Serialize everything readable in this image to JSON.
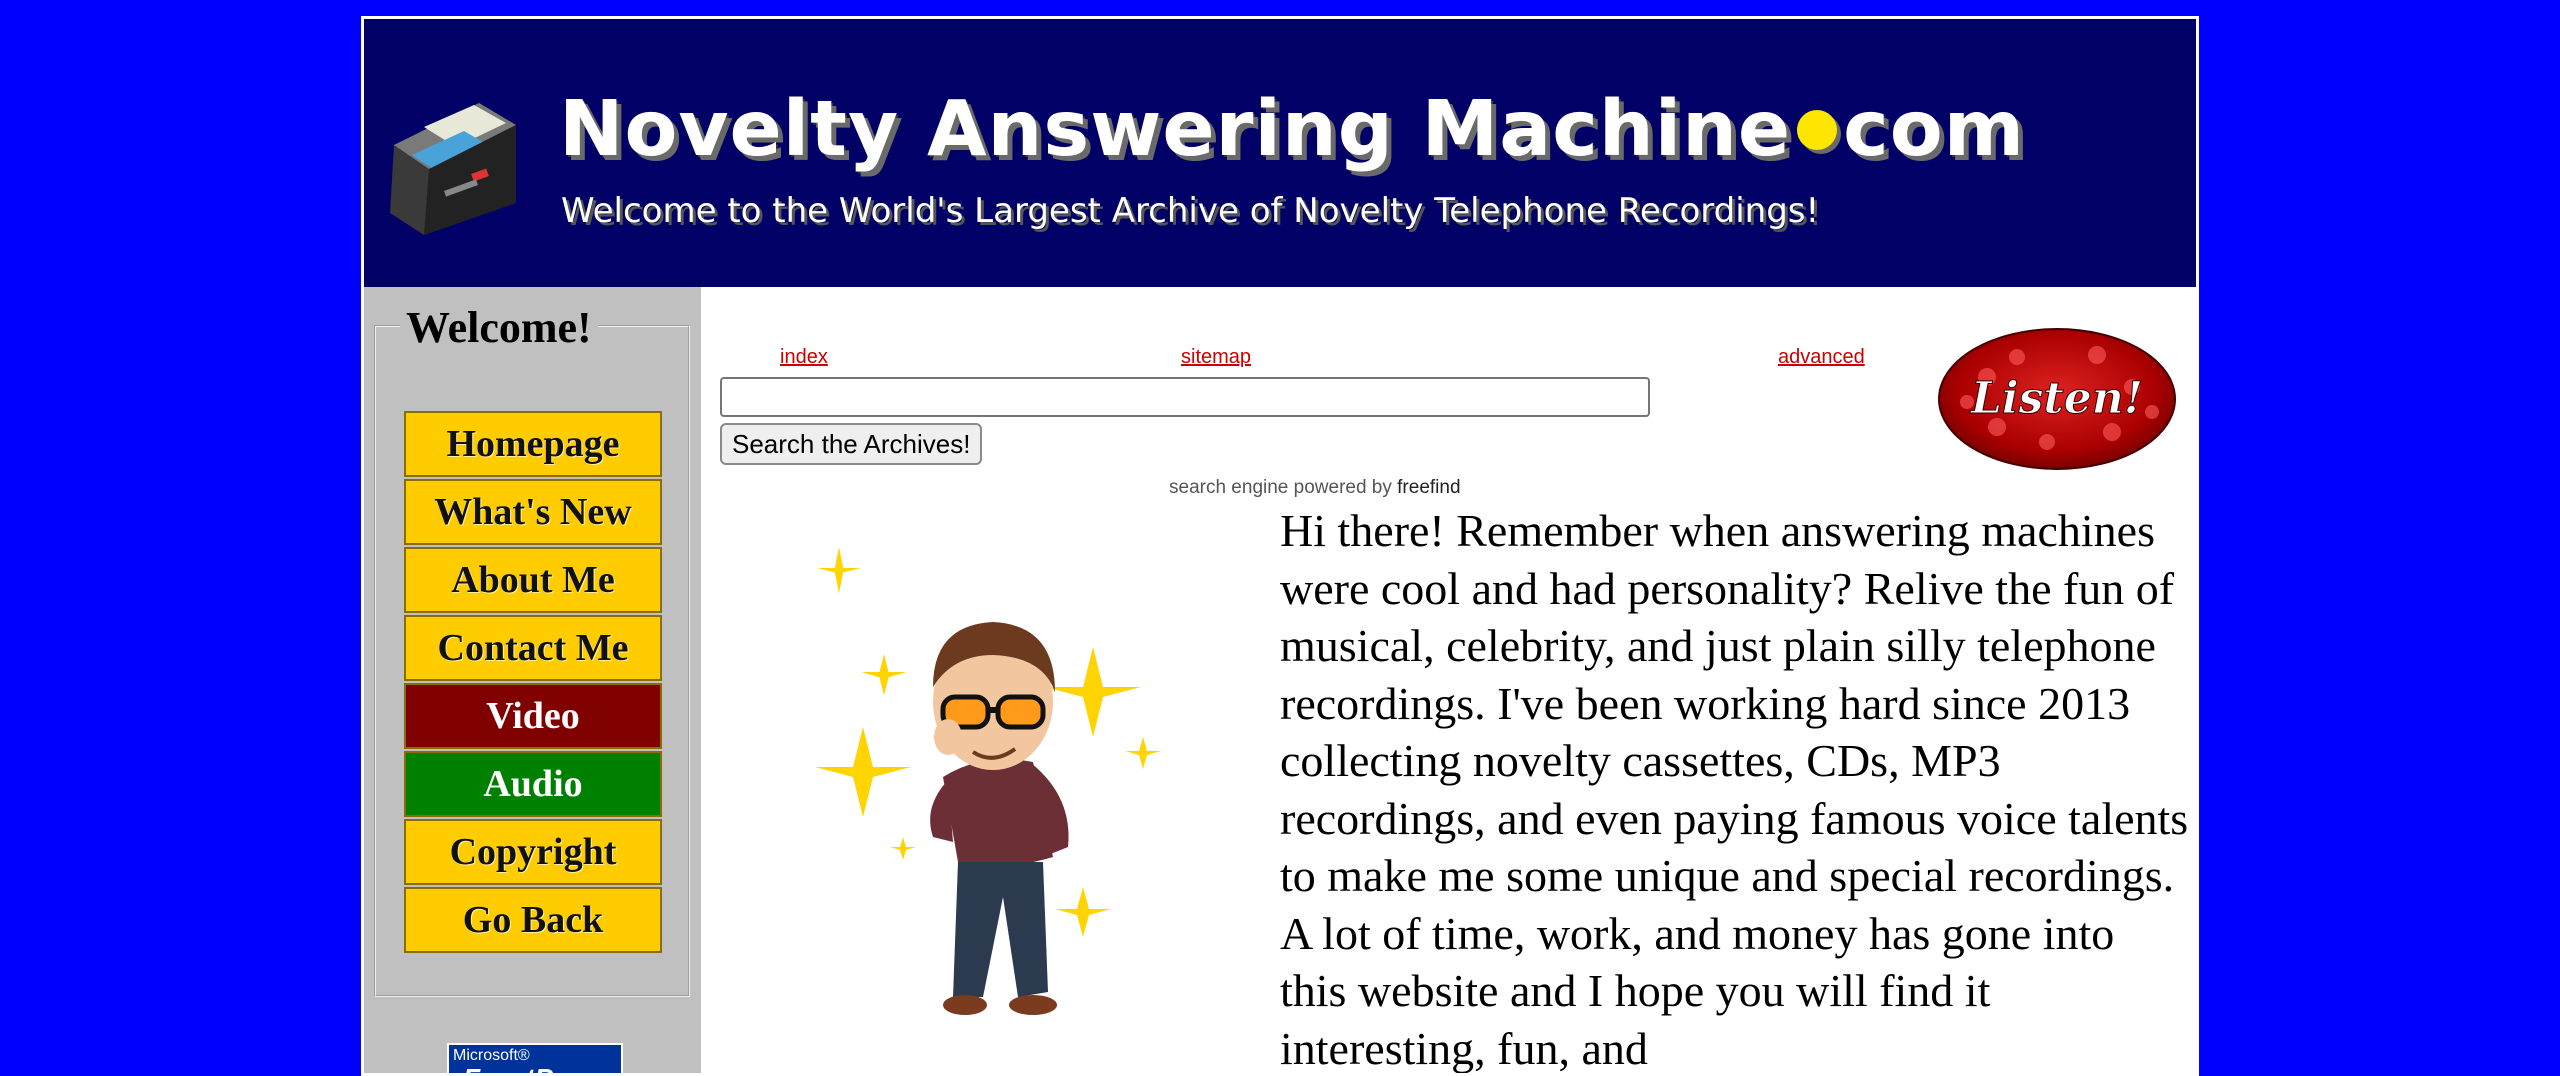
{
  "banner": {
    "title_part1": "Novelty Answering Machine",
    "title_part2": "com",
    "subtitle": "Welcome to the World's Largest Archive of Novelty Telephone Recordings!"
  },
  "sidebar": {
    "legend": "Welcome!",
    "nav": [
      {
        "label": "Homepage"
      },
      {
        "label": "What's New"
      },
      {
        "label": "About Me"
      },
      {
        "label": "Contact Me"
      },
      {
        "label": "Video"
      },
      {
        "label": "Audio"
      },
      {
        "label": "Copyright"
      },
      {
        "label": "Go Back"
      }
    ],
    "badge_small": "Microsoft®",
    "badge_big": "FrontPage"
  },
  "search": {
    "links": {
      "index": "index",
      "sitemap": "sitemap",
      "advanced": "advanced"
    },
    "input_value": "",
    "button_label": "Search the Archives!",
    "powered_prefix": "search engine powered by",
    "powered_brand": "freefind",
    "listen_label": "Listen!"
  },
  "main": {
    "intro": "Hi there! Remember when answering machines were cool and had personality? Relive the fun of musical, celebrity, and just plain silly telephone recordings. I've been working hard since 2013 collecting novelty cassettes, CDs, MP3 recordings, and even paying famous voice talents to make me some unique and special recordings. A lot of time, work, and money has gone into this website and I hope you will find it interesting, fun, and"
  },
  "colors": {
    "page_background": "#0000ff",
    "banner_background": "#000066",
    "nav_yellow": "#ffcc00",
    "nav_red": "#800000",
    "nav_green": "#008000",
    "link_red": "#cc0000"
  }
}
